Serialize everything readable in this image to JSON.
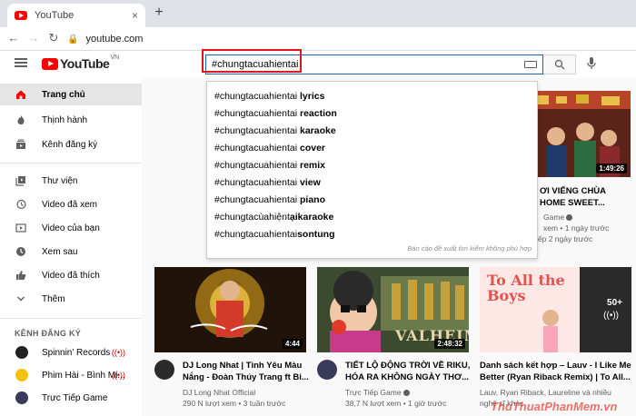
{
  "browser": {
    "tab_title": "YouTube",
    "close_glyph": "×",
    "newtab_glyph": "+",
    "url": "youtube.com"
  },
  "header": {
    "logo_text": "YouTube",
    "country": "VN",
    "search_query": "#chungtacuahientai"
  },
  "suggestions": {
    "prefix": "#chungtacuahientai",
    "items": [
      {
        "suffix": " lyrics"
      },
      {
        "suffix": " reaction"
      },
      {
        "suffix": " karaoke"
      },
      {
        "suffix": " cover"
      },
      {
        "suffix": " remix"
      },
      {
        "suffix": " view"
      },
      {
        "suffix": " piano"
      }
    ],
    "item8_prefix": "#chungtacùahiệnt",
    "item8_suffix": "ạikaraoke",
    "item9_prefix": "#chungtacuahientai",
    "item9_suffix": "sontung",
    "report": "Báo cáo đề xuất tìm kiếm không phù hợp"
  },
  "sidebar": {
    "items": [
      {
        "label": "Trang chủ",
        "icon": "home-icon"
      },
      {
        "label": "Thịnh hành",
        "icon": "flame-icon"
      },
      {
        "label": "Kênh đăng ký",
        "icon": "subscriptions-icon"
      },
      {
        "label": "Thư viện",
        "icon": "library-icon"
      },
      {
        "label": "Video đã xem",
        "icon": "history-icon"
      },
      {
        "label": "Video của bạn",
        "icon": "your-videos-icon"
      },
      {
        "label": "Xem sau",
        "icon": "clock-icon"
      },
      {
        "label": "Video đã thích",
        "icon": "thumbs-up-icon"
      },
      {
        "label": "Thêm",
        "icon": "chevron-down-icon"
      }
    ],
    "subscriptions_heading": "KÊNH ĐĂNG KÝ",
    "channels": [
      {
        "label": "Spinnin' Records",
        "color": "#222222"
      },
      {
        "label": "Phim Hài - Bình Mi...",
        "color": "#f4c20d"
      },
      {
        "label": "Trực Tiếp Game",
        "color": "#3a3a5a"
      }
    ]
  },
  "top_right_video": {
    "duration": "1:49:26",
    "title1": "ƠI VIẾNG CHÙA",
    "title2": "HOME SWEET...",
    "channel": "Game",
    "meta": "xem • 1 ngày trước",
    "meta2": "iếp 2 ngày trước"
  },
  "videos": [
    {
      "duration": "4:44",
      "title1": "DJ Long Nhat | Tình Yêu Màu",
      "title2": "Nắng - Đoàn Thúy Trang ft Bi...",
      "channel": "DJ Long Nhat Official",
      "meta": "290 N lượt xem • 3 tuần trước"
    },
    {
      "duration": "2:48:32",
      "title1": "TIẾT LỘ ĐỘNG TRỜI VỀ RIKU,",
      "title2": "HÓA RA KHÔNG NGÀY THƠ...",
      "channel": "Trực Tiếp Game",
      "meta": "38,7 N lượt xem • 1 giờ trước"
    },
    {
      "duration": "50+",
      "title1": "Danh sách kết hợp – Lauv - I Like Me",
      "title2": "Better (Ryan Riback Remix) | To All...",
      "channel": "Lauv, Ryan Riback, Laureline và nhiều",
      "meta": "nghệ sĩ khác"
    }
  ],
  "thumb_text": {
    "valheim": "VALHEIM",
    "toall": "To All the Boys"
  },
  "watermark": "ThuThuatPhanMem.vn"
}
